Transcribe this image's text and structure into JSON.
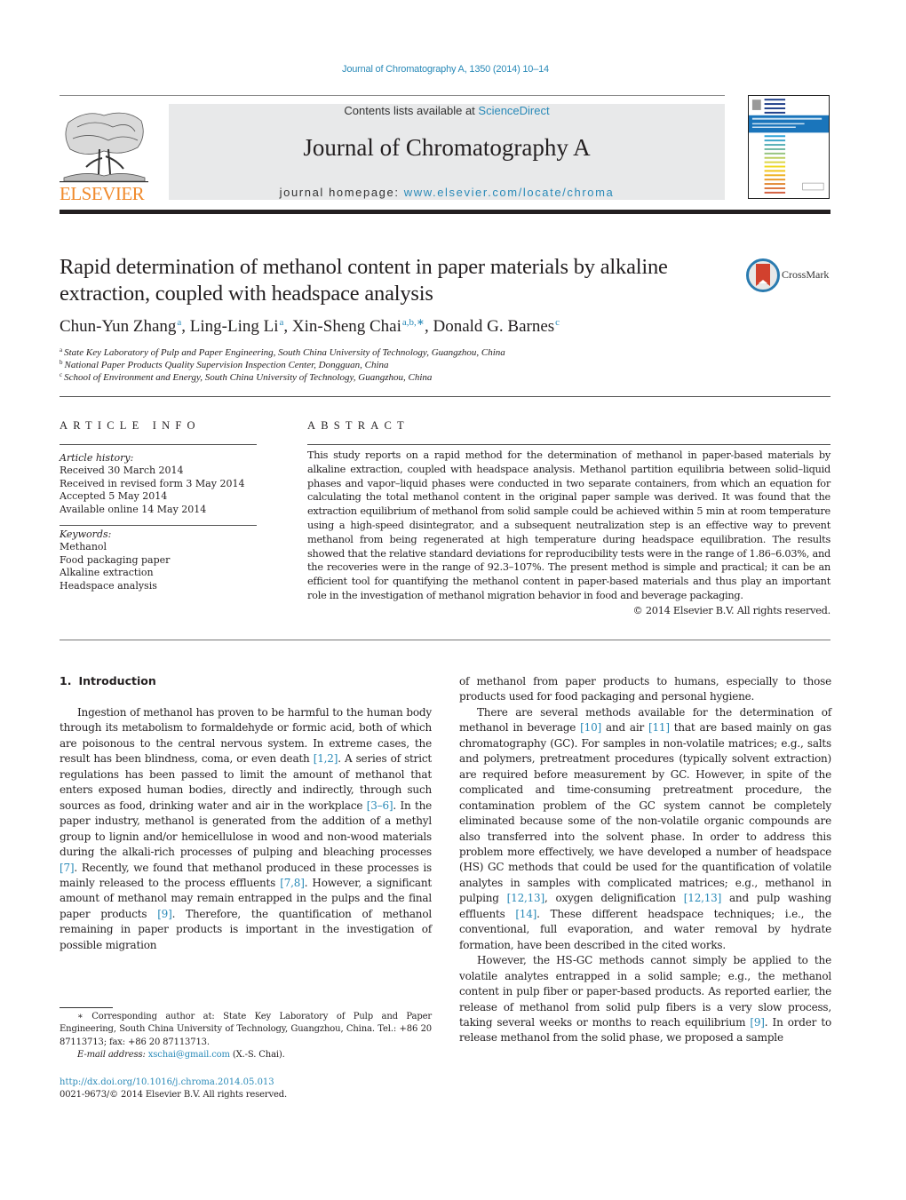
{
  "header": {
    "citation": "Journal of Chromatography A, 1350 (2014) 10–14",
    "contents_prefix": "Contents lists available at ",
    "contents_link": "ScienceDirect",
    "journal_name": "Journal of Chromatography A",
    "homepage_prefix": "journal homepage: ",
    "homepage_link": "www.elsevier.com/locate/chroma",
    "publisher_logo": "ELSEVIER",
    "crossmark_label": "CrossMark"
  },
  "colors": {
    "link": "#2a8ab8",
    "elsevier_orange": "#f08a2c",
    "banner_bg": "#e8e9ea",
    "cover_blue": "#1a75bb"
  },
  "article": {
    "title": "Rapid determination of methanol content in paper materials by alkaline extraction, coupled with headspace analysis",
    "authors": [
      {
        "name": "Chun-Yun Zhang",
        "sup": "a"
      },
      {
        "name": "Ling-Ling Li",
        "sup": "a"
      },
      {
        "name": "Xin-Sheng Chai",
        "sup": "a,b,∗"
      },
      {
        "name": "Donald G. Barnes",
        "sup": "c"
      }
    ],
    "affiliations": [
      {
        "mark": "a",
        "text": "State Key Laboratory of Pulp and Paper Engineering, South China University of Technology, Guangzhou, China"
      },
      {
        "mark": "b",
        "text": "National Paper Products Quality Supervision Inspection Center, Dongguan, China"
      },
      {
        "mark": "c",
        "text": "School of Environment and Energy, South China University of Technology, Guangzhou, China"
      }
    ]
  },
  "article_info": {
    "heading": "ARTICLE INFO",
    "history_label": "Article history:",
    "history": [
      "Received 30 March 2014",
      "Received in revised form 3 May 2014",
      "Accepted 5 May 2014",
      "Available online 14 May 2014"
    ],
    "keywords_label": "Keywords:",
    "keywords": [
      "Methanol",
      "Food packaging paper",
      "Alkaline extraction",
      "Headspace analysis"
    ]
  },
  "abstract": {
    "heading": "ABSTRACT",
    "text": "This study reports on a rapid method for the determination of methanol in paper-based materials by alkaline extraction, coupled with headspace analysis. Methanol partition equilibria between solid–liquid phases and vapor–liquid phases were conducted in two separate containers, from which an equation for calculating the total methanol content in the original paper sample was derived. It was found that the extraction equilibrium of methanol from solid sample could be achieved within 5 min at room temperature using a high-speed disintegrator, and a subsequent neutralization step is an effective way to prevent methanol from being regenerated at high temperature during headspace equilibration. The results showed that the relative standard deviations for reproducibility tests were in the range of 1.86–6.03%, and the recoveries were in the range of 92.3–107%. The present method is simple and practical; it can be an efficient tool for quantifying the methanol content in paper-based materials and thus play an important role in the investigation of methanol migration behavior in food and beverage packaging.",
    "copyright": "© 2014 Elsevier B.V. All rights reserved."
  },
  "section": {
    "number": "1.",
    "title": "Introduction"
  },
  "body": {
    "left_p1": [
      {
        "t": "Ingestion of methanol has proven to be harmful to the human body through its metabolism to formaldehyde or formic acid, both of which are poisonous to the central nervous system. In extreme cases, the result has been blindness, coma, or even death "
      },
      {
        "ref": "[1,2]"
      },
      {
        "t": ". A series of strict regulations has been passed to limit the amount of methanol that enters exposed human bodies, directly and indirectly, through such sources as food, drinking water and air in the workplace "
      },
      {
        "ref": "[3–6]"
      },
      {
        "t": ". In the paper industry, methanol is generated from the addition of a methyl group to lignin and/or hemicellulose in wood and non-wood materials during the alkali-rich processes of pulping and bleaching processes "
      },
      {
        "ref": "[7]"
      },
      {
        "t": ". Recently, we found that methanol produced in these processes is mainly released to the process effluents "
      },
      {
        "ref": "[7,8]"
      },
      {
        "t": ". However, a significant amount of methanol may remain entrapped in the pulps and the final paper products "
      },
      {
        "ref": "[9]"
      },
      {
        "t": ". Therefore, the quantification of methanol remaining in paper products is important in the investigation of possible migration"
      }
    ],
    "right_p0": [
      {
        "t": "of methanol from paper products to humans, especially to those products used for food packaging and personal hygiene."
      }
    ],
    "right_p1": [
      {
        "t": "There are several methods available for the determination of methanol in beverage "
      },
      {
        "ref": "[10]"
      },
      {
        "t": " and air "
      },
      {
        "ref": "[11]"
      },
      {
        "t": " that are based mainly on gas chromatography (GC). For samples in non-volatile matrices; e.g., salts and polymers, pretreatment procedures (typically solvent extraction) are required before measurement by GC. However, in spite of the complicated and time-consuming pretreatment procedure, the contamination problem of the GC system cannot be completely eliminated because some of the non-volatile organic compounds are also transferred into the solvent phase. In order to address this problem more effectively, we have developed a number of headspace (HS) GC methods that could be used for the quantification of volatile analytes in samples with complicated matrices; e.g., methanol in pulping "
      },
      {
        "ref": "[12,13]"
      },
      {
        "t": ", oxygen delignification "
      },
      {
        "ref": "[12,13]"
      },
      {
        "t": " and pulp washing effluents "
      },
      {
        "ref": "[14]"
      },
      {
        "t": ". These different headspace techniques; i.e., the conventional, full evaporation, and water removal by hydrate formation, have been described in the cited works."
      }
    ],
    "right_p2": [
      {
        "t": "However, the HS-GC methods cannot simply be applied to the volatile analytes entrapped in a solid sample; e.g., the methanol content in pulp fiber or paper-based products. As reported earlier, the release of methanol from solid pulp fibers is a very slow process, taking several weeks or months to reach equilibrium "
      },
      {
        "ref": "[9]"
      },
      {
        "t": ". In order to release methanol from the solid phase, we proposed a sample"
      }
    ]
  },
  "footnote": {
    "corresponding": "∗ Corresponding author at: State Key Laboratory of Pulp and Paper Engineering, South China University of Technology, Guangzhou, China. Tel.: +86 20 87113713; fax: +86 20 87113713.",
    "email_label": "E-mail address: ",
    "email": "xschai@gmail.com",
    "email_suffix": " (X.-S. Chai).",
    "doi": "http://dx.doi.org/10.1016/j.chroma.2014.05.013",
    "issn": "0021-9673/© 2014 Elsevier B.V. All rights reserved."
  },
  "icons": {
    "publisher_logo": "elsevier-tree-icon",
    "cover": "journal-cover-thumbnail",
    "crossmark": "crossmark-icon"
  }
}
